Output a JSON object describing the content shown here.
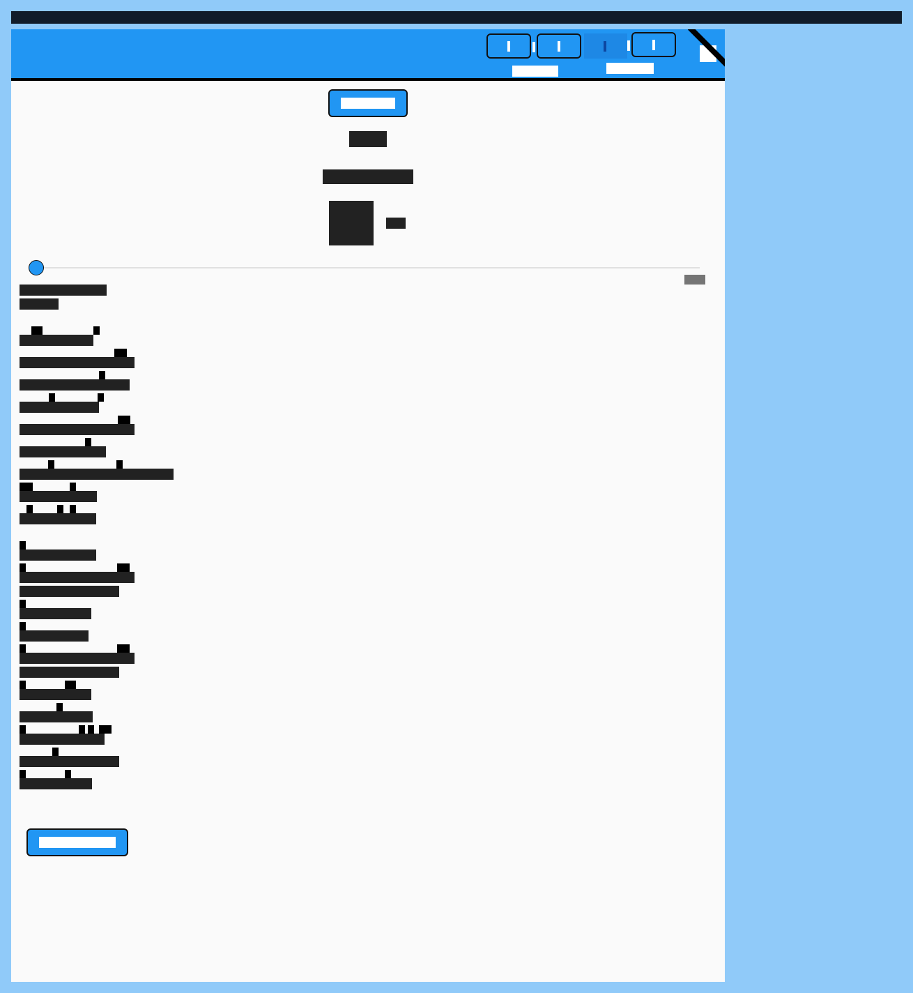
{
  "window": {
    "title": ""
  },
  "header": {
    "buttons": [
      {
        "label": ""
      },
      {
        "label": ""
      },
      {
        "label": ""
      }
    ],
    "labels": [
      "",
      ""
    ]
  },
  "main": {
    "top_button": "",
    "heading": "",
    "subheading": "",
    "avatar_caption": "",
    "slider": {
      "value_label": "",
      "level": 0.0
    },
    "summary": [
      "",
      ""
    ],
    "group_a": [
      "",
      "",
      "",
      "",
      "",
      "",
      "",
      "",
      ""
    ],
    "group_b": [
      "",
      "",
      "",
      "",
      "",
      "",
      "",
      "",
      "",
      "",
      "",
      ""
    ],
    "bottom_button": ""
  },
  "colors": {
    "accent": "#2196f3",
    "background": "#90caf9",
    "surface": "#fafafa",
    "text": "#222222"
  }
}
